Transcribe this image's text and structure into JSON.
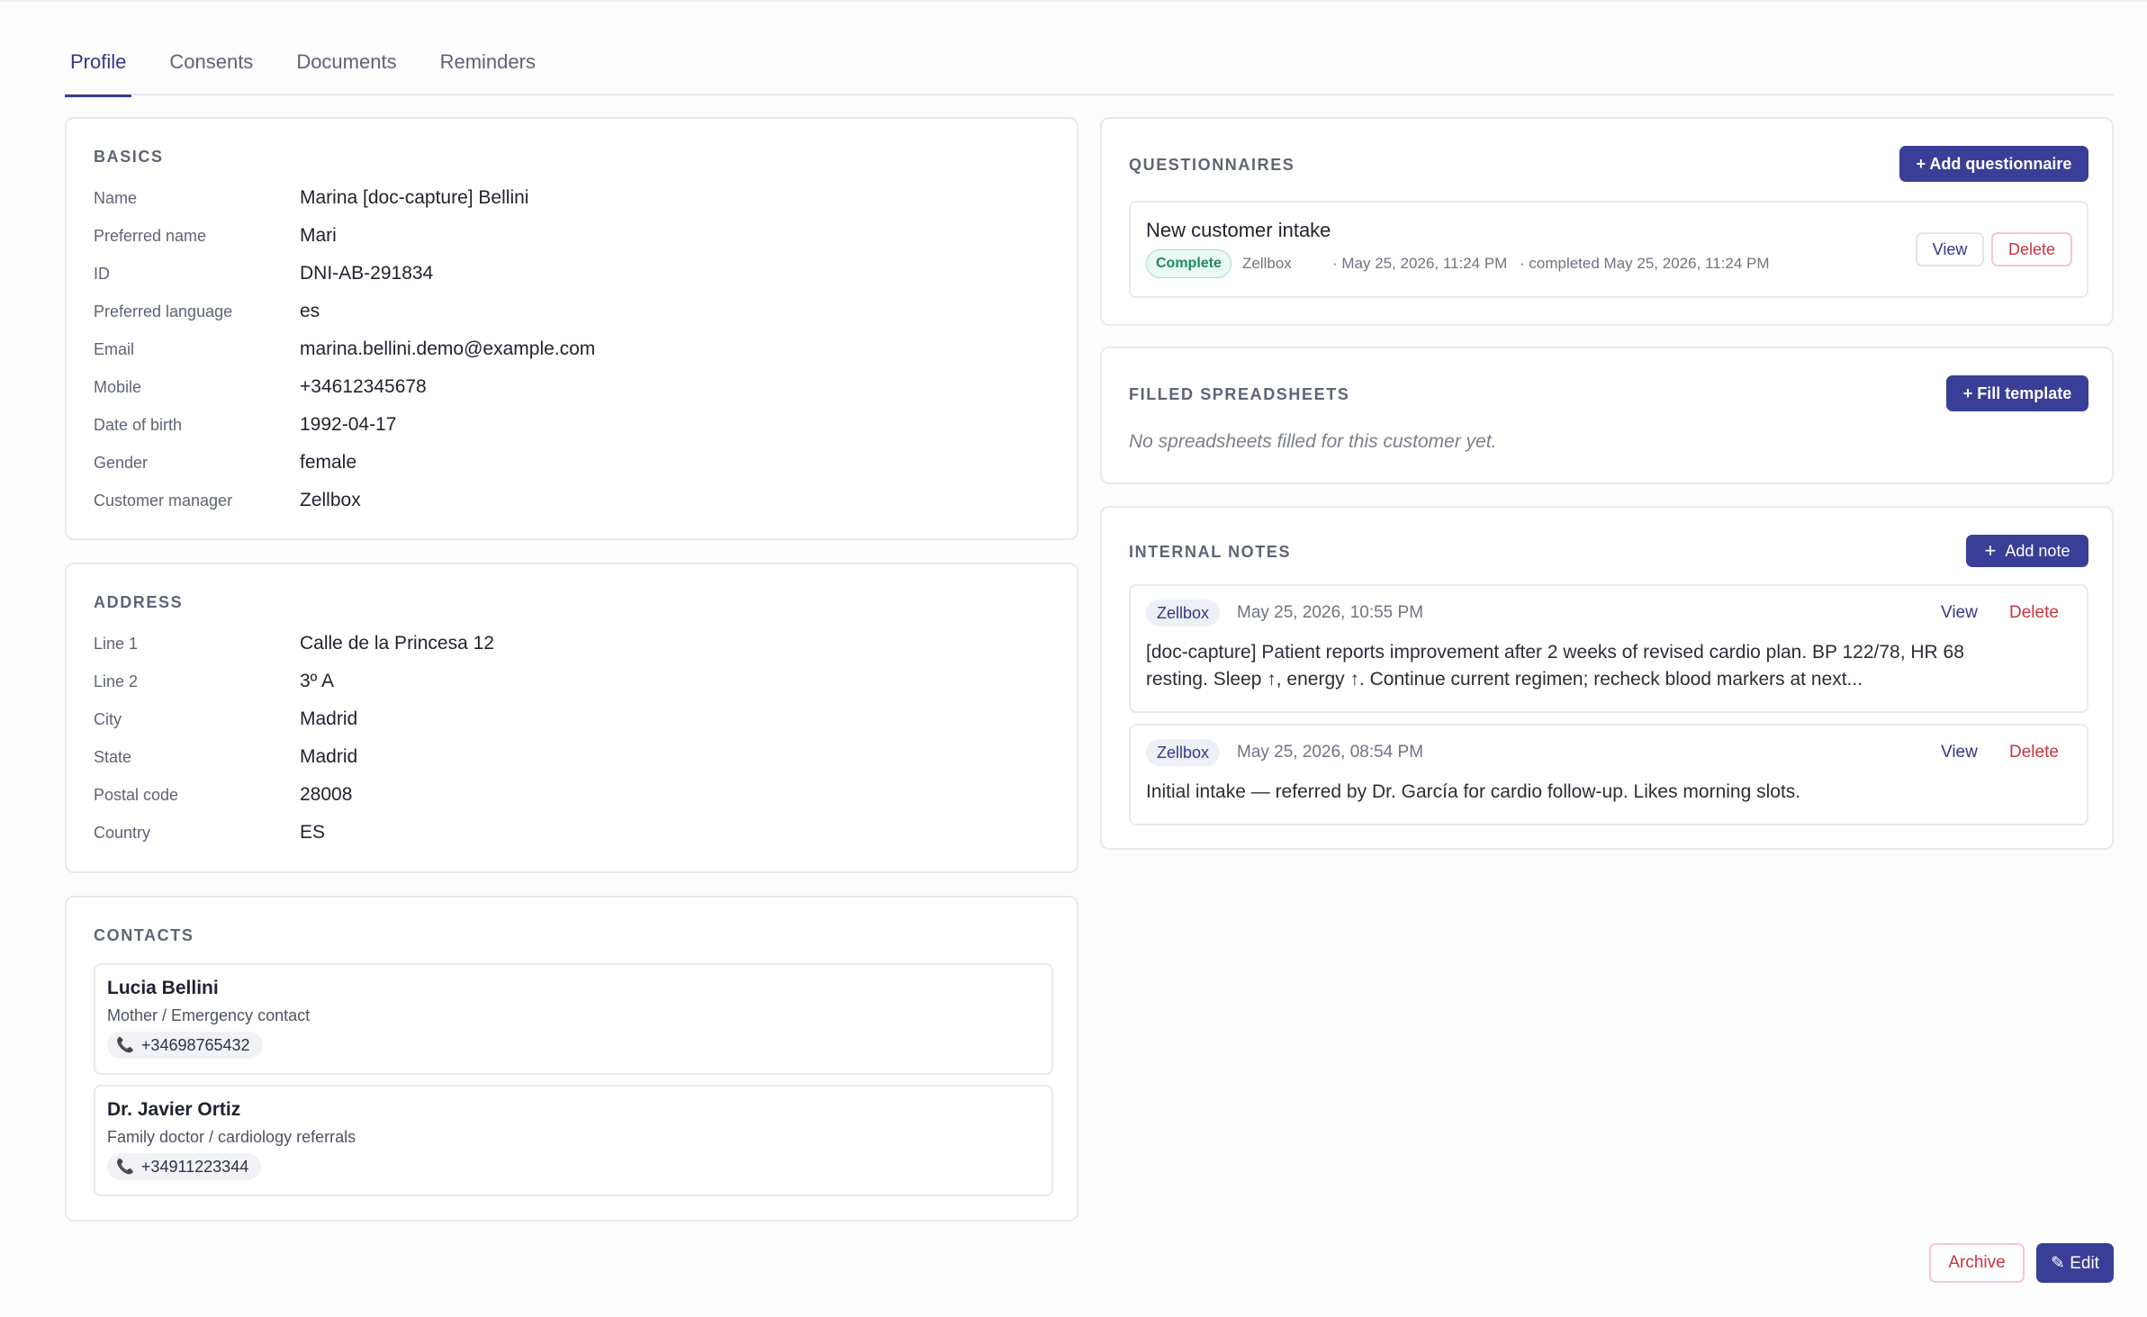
{
  "tabs": [
    {
      "label": "Profile",
      "active": true
    },
    {
      "label": "Consents",
      "active": false
    },
    {
      "label": "Documents",
      "active": false
    },
    {
      "label": "Reminders",
      "active": false
    }
  ],
  "basics": {
    "title": "BASICS",
    "rows": [
      {
        "label": "Name",
        "value": "Marina [doc-capture] Bellini"
      },
      {
        "label": "Preferred name",
        "value": "Mari"
      },
      {
        "label": "ID",
        "value": "DNI-AB-291834"
      },
      {
        "label": "Preferred language",
        "value": "es"
      },
      {
        "label": "Email",
        "value": "marina.bellini.demo@example.com"
      },
      {
        "label": "Mobile",
        "value": "+34612345678"
      },
      {
        "label": "Date of birth",
        "value": "1992-04-17"
      },
      {
        "label": "Gender",
        "value": "female"
      },
      {
        "label": "Customer manager",
        "value": "Zellbox"
      }
    ]
  },
  "address": {
    "title": "ADDRESS",
    "rows": [
      {
        "label": "Line 1",
        "value": "Calle de la Princesa 12"
      },
      {
        "label": "Line 2",
        "value": "3º A"
      },
      {
        "label": "City",
        "value": "Madrid"
      },
      {
        "label": "State",
        "value": "Madrid"
      },
      {
        "label": "Postal code",
        "value": "28008"
      },
      {
        "label": "Country",
        "value": "ES"
      }
    ]
  },
  "contacts": {
    "title": "CONTACTS",
    "items": [
      {
        "name": "Lucia Bellini",
        "relation": "Mother / Emergency contact",
        "phone": "+34698765432"
      },
      {
        "name": "Dr. Javier Ortiz",
        "relation": "Family doctor / cardiology referrals",
        "phone": "+34911223344"
      }
    ]
  },
  "questionnaires": {
    "title": "QUESTIONNAIRES",
    "add_label": "+ Add questionnaire",
    "items": [
      {
        "name": "New customer intake",
        "status": "Complete",
        "author": "Zellbox",
        "created": "· May 25, 2026, 11:24 PM",
        "completed": "· completed May 25, 2026, 11:24 PM",
        "view_label": "View",
        "delete_label": "Delete"
      }
    ]
  },
  "spreadsheets": {
    "title": "FILLED SPREADSHEETS",
    "add_label": "+ Fill template",
    "empty": "No spreadsheets filled for this customer yet."
  },
  "notes": {
    "title": "INTERNAL NOTES",
    "add_label": "Add note",
    "add_icon": "plus-icon",
    "items": [
      {
        "author": "Zellbox",
        "timestamp": "May 25, 2026, 10:55 PM",
        "text_line1": "[doc-capture] Patient reports improvement after 2 weeks of revised cardio plan. BP 122/78, HR 68",
        "text_line2": "resting. Sleep ↑, energy ↑. Continue current regimen; recheck blood markers at next...",
        "view_label": "View",
        "delete_label": "Delete"
      },
      {
        "author": "Zellbox",
        "timestamp": "May 25, 2026, 08:54 PM",
        "text_line1": "Initial intake — referred by Dr. García for cardio follow-up. Likes morning slots.",
        "view_label": "View",
        "delete_label": "Delete"
      }
    ]
  },
  "footer": {
    "archive_label": "Archive",
    "edit_label": "✎ Edit"
  },
  "colors": {
    "accent": "#393f96",
    "danger": "#c7343f",
    "success": "#1d8a59"
  }
}
